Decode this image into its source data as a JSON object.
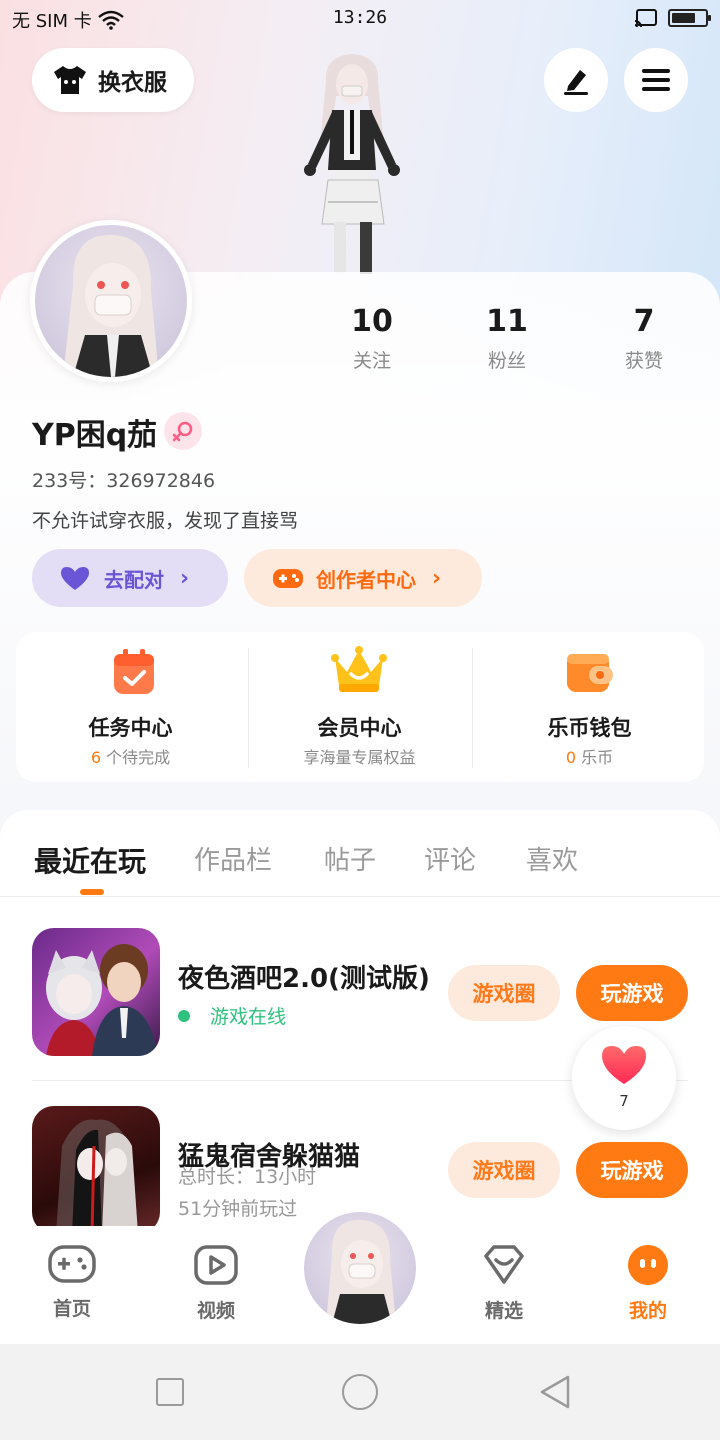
{
  "status": {
    "carrier": "无 SIM 卡",
    "time": "13:26",
    "battery_level": 0.75
  },
  "header": {
    "outfit_label": "换衣服",
    "edit_icon": "pen-icon",
    "menu_icon": "menu-icon"
  },
  "profile": {
    "following_count": "10",
    "following_label": "关注",
    "fans_count": "11",
    "fans_label": "粉丝",
    "likes_count": "7",
    "likes_label": "获赞",
    "name": "YP困q茄",
    "gender": "female",
    "id_line": "233号：326972846",
    "bio": "不允许试穿衣服，发现了直接骂",
    "match_label": "去配对",
    "creator_label": "创作者中心"
  },
  "quick": {
    "task_title": "任务中心",
    "task_count": "6",
    "task_suffix": "个待完成",
    "vip_title": "会员中心",
    "vip_sub": "享海量专属权益",
    "wallet_title": "乐币钱包",
    "wallet_count": "0",
    "wallet_suffix": "乐币"
  },
  "tabs": {
    "recent": "最近在玩",
    "works": "作品栏",
    "posts": "帖子",
    "comments": "评论",
    "likes": "喜欢"
  },
  "games": [
    {
      "name": "夜色酒吧2.0(测试版)",
      "status": "游戏在线",
      "circle_label": "游戏圈",
      "play_label": "玩游戏"
    },
    {
      "name": "猛鬼宿舍躲猫猫",
      "duration": "总时长：13小时",
      "last_played": "51分钟前玩过",
      "circle_label": "游戏圈",
      "play_label": "玩游戏"
    }
  ],
  "like_float": {
    "count": "7"
  },
  "nav": {
    "home": "首页",
    "video": "视频",
    "featured": "精选",
    "mine": "我的"
  },
  "colors": {
    "accent": "#ff7a12",
    "accent_light": "#feeadc",
    "match_bg": "#e3ddf6",
    "match_fg": "#6a55d6",
    "online": "#2ec27e"
  }
}
